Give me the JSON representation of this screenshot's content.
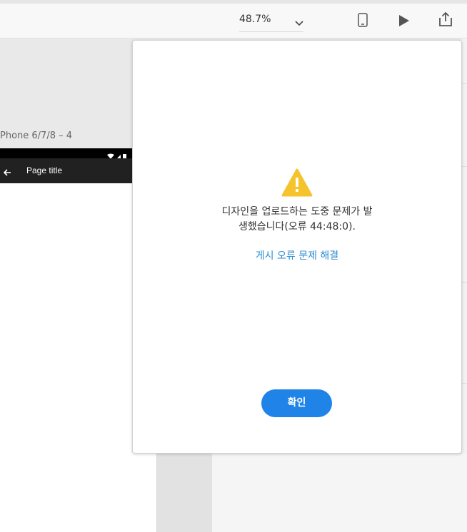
{
  "toolbar": {
    "zoom_value": "48.7%",
    "icons": [
      "chevron-down-icon",
      "mobile-device-icon",
      "play-icon",
      "share-icon"
    ]
  },
  "artboard": {
    "name": "Phone 6/7/8 – 4",
    "app_bar_title": "Page title",
    "icons": [
      "wifi-icon",
      "signal-icon",
      "battery-icon",
      "back-arrow-icon"
    ]
  },
  "dialog": {
    "icon": "warning-icon",
    "message_line1": "디자인을 업로드하는 도중 문제가 발",
    "message_line2": "생했습니다(오류 44:48:0).",
    "help_link": "게시 오류 문제 해결",
    "ok_label": "확인"
  },
  "colors": {
    "accent": "#1f83e8",
    "link": "#2a8bd0",
    "warning": "#f5c32c",
    "app_bar": "#212121"
  }
}
